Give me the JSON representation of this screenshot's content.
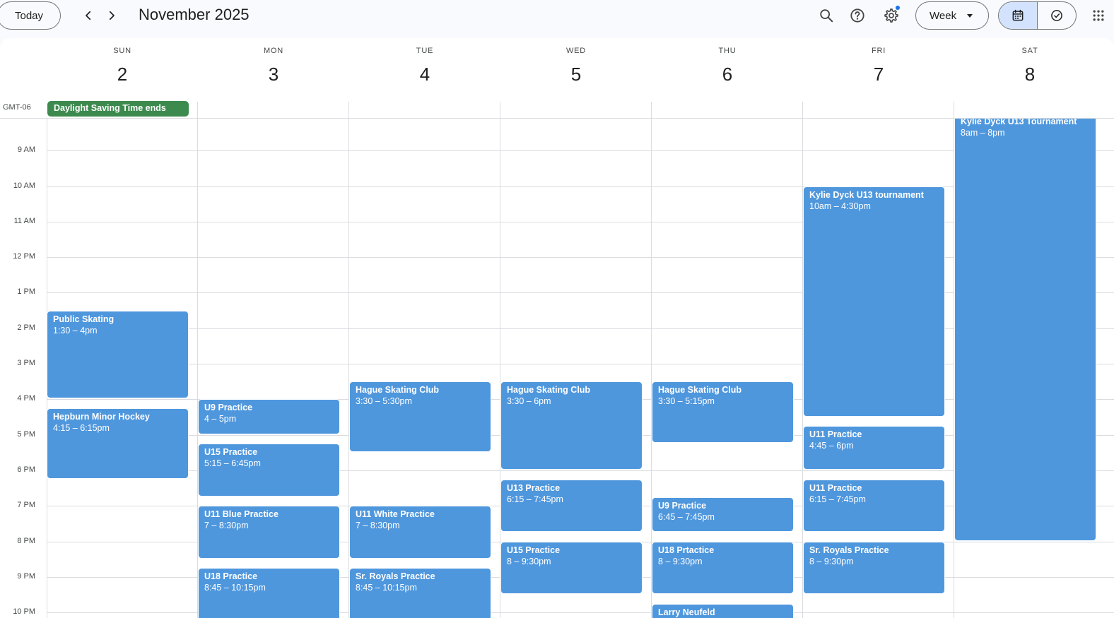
{
  "toolbar": {
    "today_label": "Today",
    "title": "November 2025",
    "view_label": "Week",
    "icons": {
      "prev": "chevron-left-icon",
      "next": "chevron-right-icon",
      "search": "search-icon",
      "help": "help-icon",
      "settings": "gear-icon",
      "calendar": "calendar-icon",
      "tasks": "task-check-icon",
      "apps": "apps-grid-icon"
    }
  },
  "colors": {
    "event": "#4f97dd",
    "holiday": "#3d8a4f",
    "accent": "#1a73e8",
    "toggle_active": "#d3e3fd"
  },
  "timezone": "GMT-06",
  "days": [
    {
      "name": "SUN",
      "num": "2"
    },
    {
      "name": "MON",
      "num": "3"
    },
    {
      "name": "TUE",
      "num": "4"
    },
    {
      "name": "WED",
      "num": "5"
    },
    {
      "name": "THU",
      "num": "6"
    },
    {
      "name": "FRI",
      "num": "7"
    },
    {
      "name": "SAT",
      "num": "8"
    }
  ],
  "all_day_event": {
    "title": "Daylight Saving Time ends",
    "day": 0
  },
  "hours": [
    "9 AM",
    "10 AM",
    "11 AM",
    "12 PM",
    "1 PM",
    "2 PM",
    "3 PM",
    "4 PM",
    "5 PM",
    "6 PM",
    "7 PM",
    "8 PM",
    "9 PM",
    "10 PM"
  ],
  "events": [
    {
      "day": 0,
      "title": "Public Skating",
      "time": "1:30 – 4pm",
      "start": 13.5,
      "end": 16
    },
    {
      "day": 0,
      "title": "Hepburn Minor Hockey",
      "time": "4:15 – 6:15pm",
      "start": 16.25,
      "end": 18.25
    },
    {
      "day": 1,
      "title": "U9 Practice",
      "time": "4 – 5pm",
      "start": 16,
      "end": 17
    },
    {
      "day": 1,
      "title": "U15 Practice",
      "time": "5:15 – 6:45pm",
      "start": 17.25,
      "end": 18.75
    },
    {
      "day": 1,
      "title": "U11 Blue Practice",
      "time": "7 – 8:30pm",
      "start": 19,
      "end": 20.5
    },
    {
      "day": 1,
      "title": "U18 Practice",
      "time": "8:45 – 10:15pm",
      "start": 20.75,
      "end": 22.25
    },
    {
      "day": 2,
      "title": "Hague Skating Club",
      "time": "3:30 – 5:30pm",
      "start": 15.5,
      "end": 17.5
    },
    {
      "day": 2,
      "title": "U11 White Practice",
      "time": "7 – 8:30pm",
      "start": 19,
      "end": 20.5
    },
    {
      "day": 2,
      "title": "Sr. Royals Practice",
      "time": "8:45 – 10:15pm",
      "start": 20.75,
      "end": 22.25
    },
    {
      "day": 3,
      "title": "Hague Skating Club",
      "time": "3:30 – 6pm",
      "start": 15.5,
      "end": 18
    },
    {
      "day": 3,
      "title": "U13 Practice",
      "time": "6:15 – 7:45pm",
      "start": 18.25,
      "end": 19.75
    },
    {
      "day": 3,
      "title": "U15 Practice",
      "time": "8 – 9:30pm",
      "start": 20,
      "end": 21.5
    },
    {
      "day": 4,
      "title": "Hague Skating Club",
      "time": "3:30 – 5:15pm",
      "start": 15.5,
      "end": 17.25
    },
    {
      "day": 4,
      "title": "U9 Practice",
      "time": "6:45 – 7:45pm",
      "start": 18.75,
      "end": 19.75
    },
    {
      "day": 4,
      "title": "U18 Prtactice",
      "time": "8 – 9:30pm",
      "start": 20,
      "end": 21.5
    },
    {
      "day": 4,
      "title": "Larry Neufeld",
      "time": "",
      "start": 21.75,
      "end": 23
    },
    {
      "day": 5,
      "title": "Kylie Dyck U13 tournament",
      "time": "10am – 4:30pm",
      "start": 10,
      "end": 16.5
    },
    {
      "day": 5,
      "title": "U11 Practice",
      "time": "4:45 – 6pm",
      "start": 16.75,
      "end": 18
    },
    {
      "day": 5,
      "title": "U11 Practice",
      "time": "6:15 – 7:45pm",
      "start": 18.25,
      "end": 19.75
    },
    {
      "day": 5,
      "title": "Sr. Royals Practice",
      "time": "8 – 9:30pm",
      "start": 20,
      "end": 21.5
    },
    {
      "day": 6,
      "title": "Kylie Dyck U13 Tournament",
      "time": "8am – 8pm",
      "start": 8,
      "end": 20
    }
  ]
}
